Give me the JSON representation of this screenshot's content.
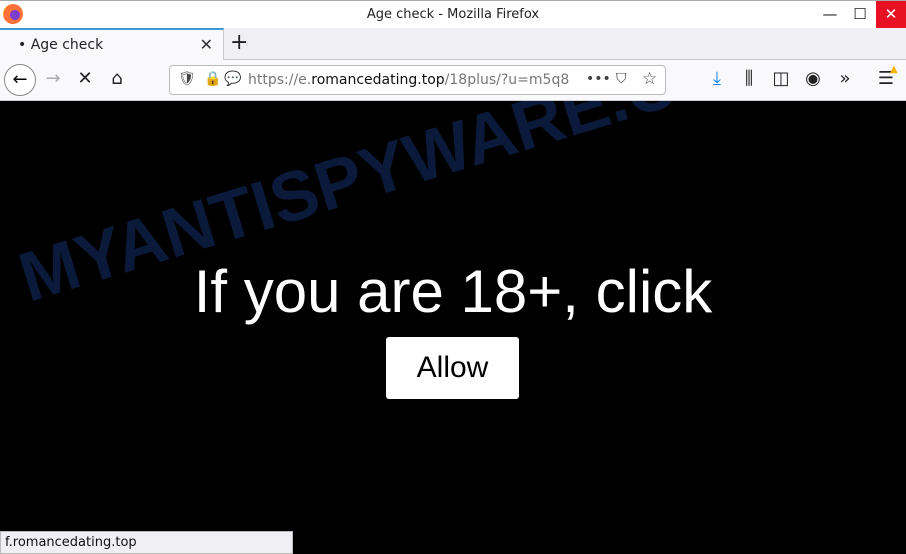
{
  "window": {
    "title": "Age check - Mozilla Firefox",
    "minimize": "—",
    "maximize": "☐",
    "close": "✕"
  },
  "tab": {
    "label": "• Age check",
    "close": "✕",
    "new_tab": "+"
  },
  "nav": {
    "back": "←",
    "forward": "→",
    "stop": "✕",
    "home": "⌂",
    "url_prefix": "https://e.",
    "url_domain": "romancedating.top",
    "url_rest": "/18plus/?u=m5q8",
    "more": "•••",
    "pocket": "⛉",
    "bookmark": "☆",
    "download": "⤓",
    "library": "⫼",
    "sidebar": "◫",
    "account": "◉",
    "overflow": "»",
    "menu": "☰"
  },
  "content": {
    "watermark": "MYANTISPYWARE.COM",
    "heading": "If you are 18+, click",
    "button": "Allow"
  },
  "status": "f.romancedating.top"
}
